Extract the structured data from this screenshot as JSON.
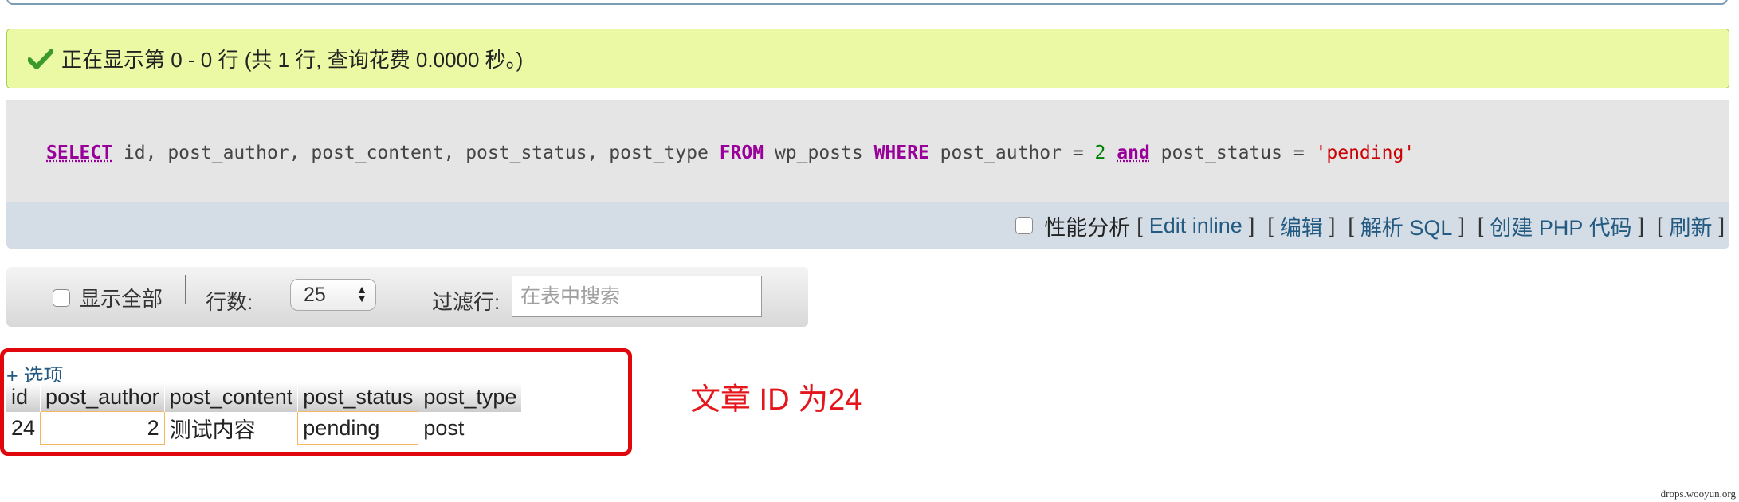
{
  "success": {
    "message": "正在显示第 0 - 0 行 (共 1 行, 查询花费 0.0000 秒。)"
  },
  "sql": {
    "kw_select": "SELECT",
    "columns": " id, post_author, post_content, post_status, post_type ",
    "kw_from": "FROM",
    "table": " wp_posts ",
    "kw_where": "WHERE",
    "cond1": " post_author = ",
    "num": "2",
    "kw_and": "and",
    "cond2": " post_status = ",
    "str": "'pending'"
  },
  "actions": {
    "profiling_label": "性能分析",
    "edit_inline": "Edit inline",
    "edit": "编辑",
    "explain": "解析 SQL",
    "create_php": "创建 PHP 代码",
    "refresh": "刷新",
    "bracket_open": "[",
    "bracket_close": "]"
  },
  "nav": {
    "show_all_label": "显示全部",
    "rows_label": "行数:",
    "rows_value": "25",
    "filter_label": "过滤行:",
    "filter_placeholder": "在表中搜索"
  },
  "results": {
    "options_link": "+ 选项",
    "columns": [
      "id",
      "post_author",
      "post_content",
      "post_status",
      "post_type"
    ],
    "rows": [
      [
        "24",
        "2",
        "测试内容",
        "pending",
        "post"
      ]
    ]
  },
  "annotation": "文章 ID 为24",
  "watermark": "drops.wooyun.org",
  "colors": {
    "success_bg": "#ebf8a4",
    "link": "#235a81",
    "annotation_red": "#e4161c",
    "keyword": "#990099"
  }
}
